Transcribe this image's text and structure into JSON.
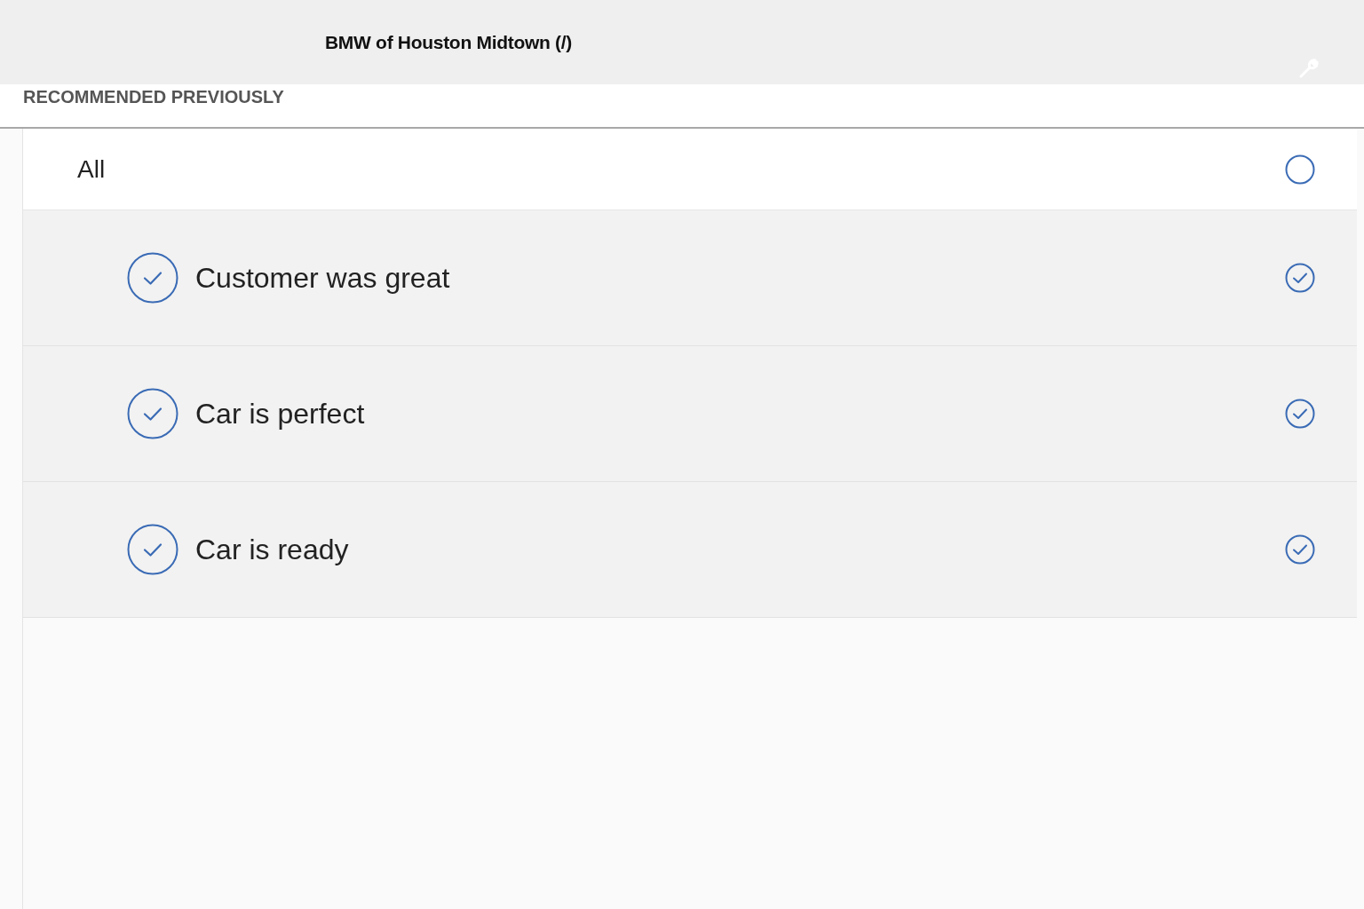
{
  "header": {
    "title": "BMW of Houston Midtown (/)"
  },
  "section_label": "RECOMMENDED PREVIOUSLY",
  "all_option": {
    "label": "All",
    "checked": false
  },
  "options": [
    {
      "label": "Customer was great",
      "checked": true
    },
    {
      "label": "Car is perfect",
      "checked": true
    },
    {
      "label": "Car is ready",
      "checked": true
    }
  ]
}
